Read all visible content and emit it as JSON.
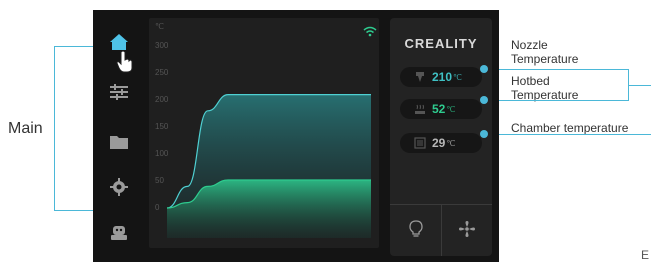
{
  "labels": {
    "main": "Main",
    "nozzle": "Nozzle\nTemperature",
    "hotbed": "Hotbed\nTemperature",
    "chamber": "Chamber temperature",
    "corner": "E"
  },
  "screen": {
    "brand": "CREALITY",
    "chart": {
      "unit": "℃",
      "yticks": [
        "300",
        "250",
        "200",
        "150",
        "100",
        "50",
        "0"
      ]
    },
    "nozzle": {
      "value": "210",
      "unit": "℃",
      "color": "#3fc1c4"
    },
    "hotbed": {
      "value": "52",
      "unit": "℃",
      "color": "#2ecc8f"
    },
    "chamber": {
      "value": "29",
      "unit": "℃",
      "color": "#b8b8b8"
    },
    "sidebar": [
      "home-icon",
      "settings-sliders-icon",
      "folder-icon",
      "gear-icon",
      "robot-icon"
    ],
    "bottom": [
      "light-bulb-icon",
      "fan-icon"
    ]
  },
  "chart_data": {
    "type": "area",
    "title": "",
    "xlabel": "",
    "ylabel": "℃",
    "ylim": [
      0,
      300
    ],
    "x": [
      0,
      10,
      20,
      30,
      40,
      50,
      60,
      70,
      80,
      90,
      100
    ],
    "series": [
      {
        "values": [
          0,
          40,
          180,
          210,
          210,
          210,
          210,
          210,
          210,
          210,
          210
        ]
      },
      {
        "values": [
          0,
          10,
          40,
          52,
          52,
          52,
          52,
          52,
          52,
          52,
          52
        ]
      }
    ]
  }
}
